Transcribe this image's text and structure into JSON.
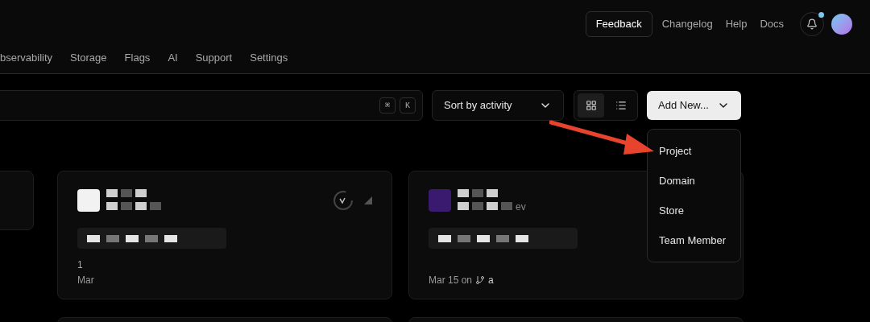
{
  "header": {
    "actions": [
      {
        "label": "Feedback",
        "kind": "button"
      },
      {
        "label": "Changelog",
        "kind": "link"
      },
      {
        "label": "Help",
        "kind": "link"
      },
      {
        "label": "Docs",
        "kind": "link"
      }
    ],
    "notifications": {
      "unread": true
    }
  },
  "nav": [
    {
      "label": "bservability"
    },
    {
      "label": "Storage"
    },
    {
      "label": "Flags"
    },
    {
      "label": "AI"
    },
    {
      "label": "Support"
    },
    {
      "label": "Settings"
    }
  ],
  "search": {
    "shortcut": [
      "⌘",
      "K"
    ]
  },
  "sort": {
    "label": "Sort by activity"
  },
  "view_toggle": [
    {
      "kind": "grid",
      "selected": true
    },
    {
      "kind": "list",
      "selected": false
    }
  ],
  "add_new": {
    "label": "Add New...",
    "expanded": true,
    "menu": [
      {
        "label": "Project"
      },
      {
        "label": "Domain"
      },
      {
        "label": "Store"
      },
      {
        "label": "Team Member"
      }
    ]
  },
  "cards": [
    {
      "kind": "status",
      "meta": "1",
      "footer": "Mar"
    },
    {
      "kind": "branch",
      "subtitle": "ev",
      "footer": "Mar 15 on",
      "branch": "a"
    }
  ]
}
